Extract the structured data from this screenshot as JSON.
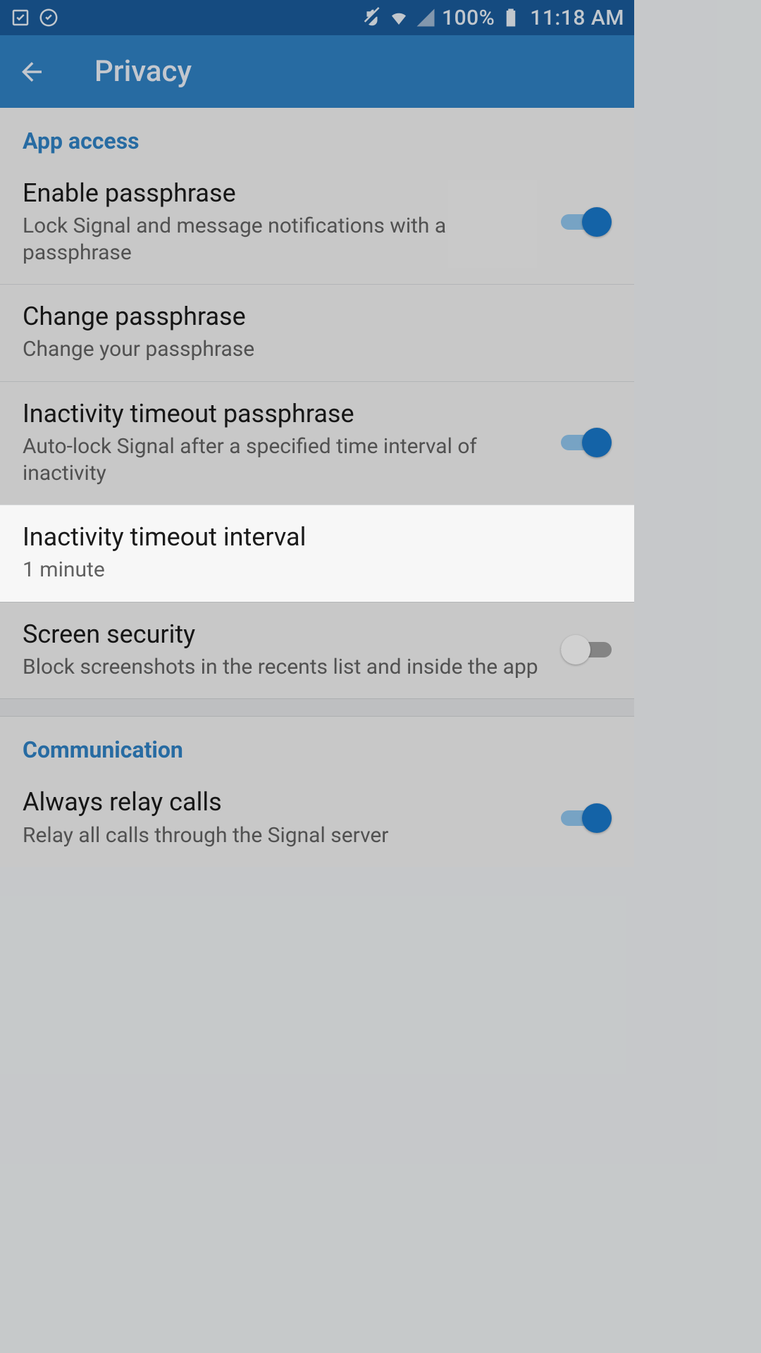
{
  "statusbar": {
    "battery": "100%",
    "time": "11:18 AM"
  },
  "appbar": {
    "title": "Privacy"
  },
  "sections": {
    "app_access": {
      "header": "App access",
      "enable_passphrase": {
        "title": "Enable passphrase",
        "sub": "Lock Signal and message notifications with a passphrase",
        "on": true
      },
      "change_passphrase": {
        "title": "Change passphrase",
        "sub": "Change your passphrase"
      },
      "inactivity_timeout": {
        "title": "Inactivity timeout passphrase",
        "sub": "Auto-lock Signal after a specified time interval of inactivity",
        "on": true
      },
      "inactivity_interval": {
        "title": "Inactivity timeout interval",
        "sub": "1 minute"
      },
      "screen_security": {
        "title": "Screen security",
        "sub": "Block screenshots in the recents list and inside the app",
        "on": false
      }
    },
    "communication": {
      "header": "Communication",
      "always_relay": {
        "title": "Always relay calls",
        "sub": "Relay all calls through the Signal server",
        "on": true
      }
    }
  },
  "colors": {
    "statusbar_bg": "#1a5a99",
    "appbar_bg": "#2f80c2",
    "accent": "#1976c8"
  }
}
